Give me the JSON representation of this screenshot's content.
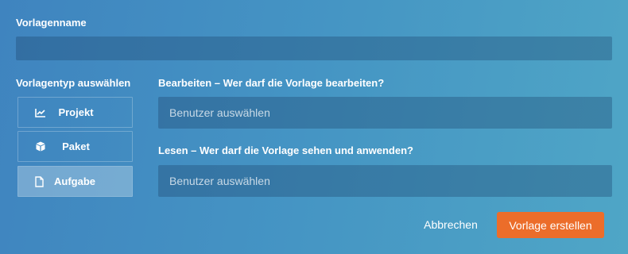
{
  "template_name": {
    "label": "Vorlagenname",
    "value": ""
  },
  "template_type": {
    "label": "Vorlagentyp auswählen",
    "options": [
      {
        "label": "Projekt",
        "icon": "chart-line-icon",
        "selected": false
      },
      {
        "label": "Paket",
        "icon": "cube-icon",
        "selected": false
      },
      {
        "label": "Aufgabe",
        "icon": "document-icon",
        "selected": true
      }
    ]
  },
  "edit_permission": {
    "label": "Bearbeiten – Wer darf die Vorlage bearbeiten?",
    "placeholder": "Benutzer auswählen"
  },
  "read_permission": {
    "label": "Lesen – Wer darf die Vorlage sehen und anwenden?",
    "placeholder": "Benutzer auswählen"
  },
  "actions": {
    "cancel_label": "Abbrechen",
    "create_label": "Vorlage erstellen"
  },
  "colors": {
    "accent": "#ec6d2a"
  }
}
